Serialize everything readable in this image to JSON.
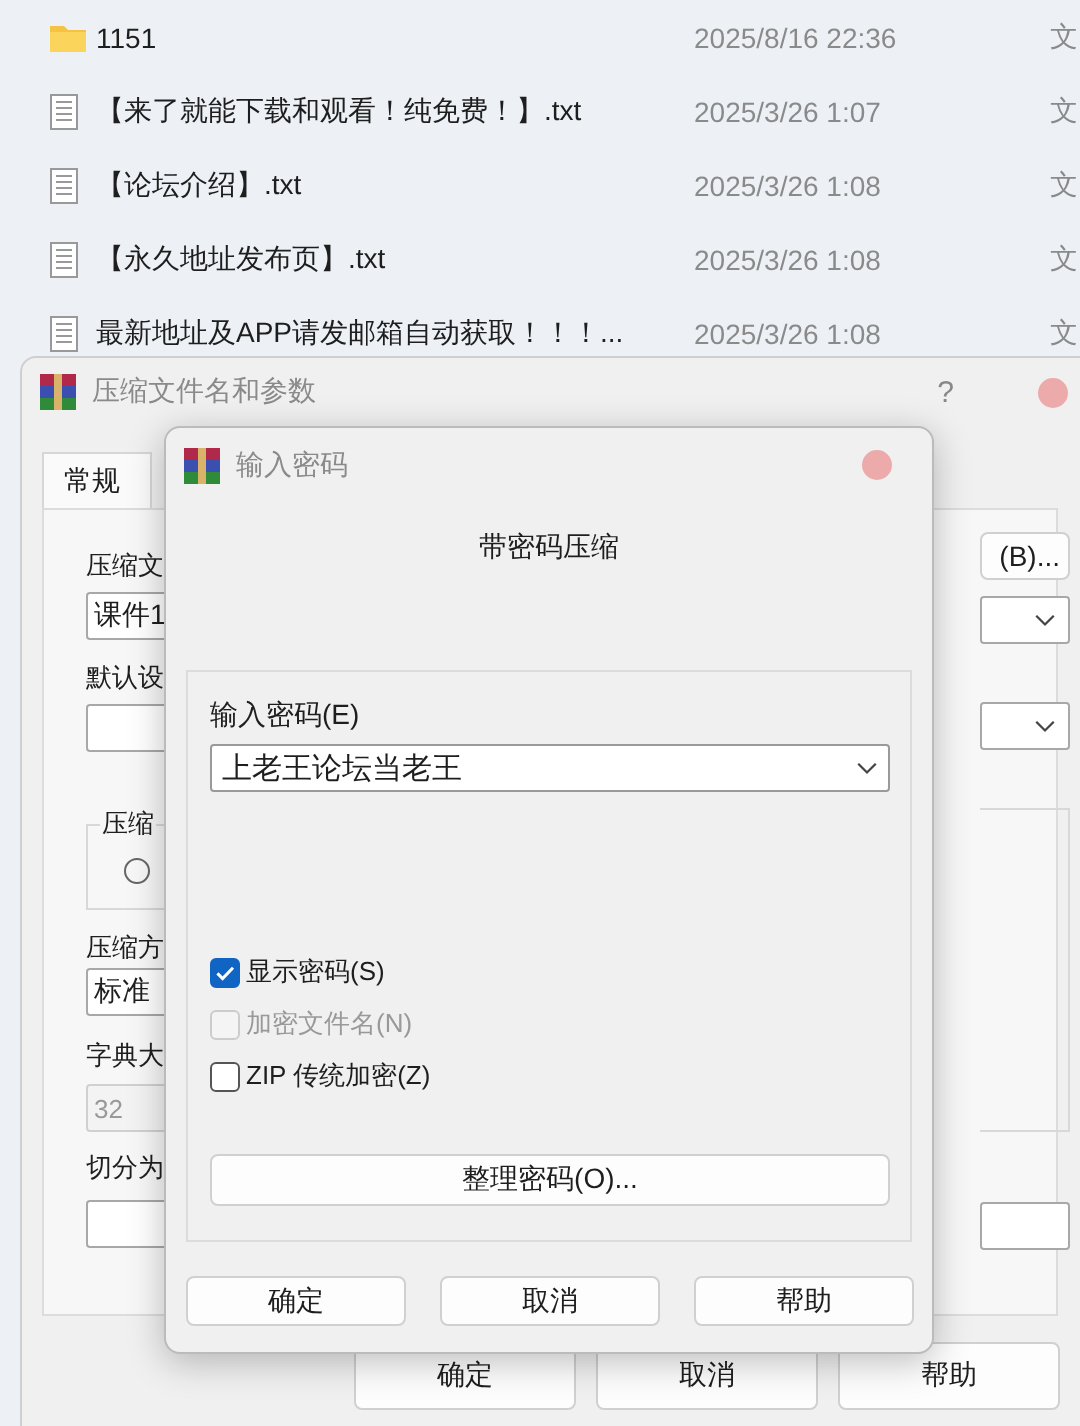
{
  "files": [
    {
      "kind": "folder",
      "name": "1151",
      "modified": "2025/8/16 22:36",
      "type": "文"
    },
    {
      "kind": "text",
      "name": "【来了就能下载和观看！纯免费！】.txt",
      "modified": "2025/3/26 1:07",
      "type": "文"
    },
    {
      "kind": "text",
      "name": "【论坛介绍】.txt",
      "modified": "2025/3/26 1:08",
      "type": "文"
    },
    {
      "kind": "text",
      "name": "【永久地址发布页】.txt",
      "modified": "2025/3/26 1:08",
      "type": "文"
    },
    {
      "kind": "text",
      "name": "最新地址及APP请发邮箱自动获取！！！...",
      "modified": "2025/3/26 1:08",
      "type": "文"
    }
  ],
  "archive_dialog": {
    "title": "压缩文件名和参数",
    "help": "?",
    "tabs": [
      {
        "label": "常规",
        "selected": true
      }
    ],
    "archive_name": {
      "label": "压缩文",
      "value": "课件1"
    },
    "browse_button": "(B)...",
    "profile_label": "默认设",
    "group_label": "压缩",
    "radio": {
      "selected": false
    },
    "method": {
      "label": "压缩方",
      "value": "标准"
    },
    "dictionary": {
      "label": "字典大",
      "value": "32",
      "disabled": true
    },
    "split_label": "切分为",
    "buttons": [
      "确定",
      "取消",
      "帮助"
    ]
  },
  "password_dialog": {
    "title": "输入密码",
    "heading": "带密码压缩",
    "password_label": "输入密码(E)",
    "password": "上老王论坛当老王",
    "options": [
      {
        "label": "显示密码(S)",
        "checked": true,
        "disabled": false
      },
      {
        "label": "加密文件名(N)",
        "checked": false,
        "disabled": true
      },
      {
        "label": "ZIP 传统加密(Z)",
        "checked": false,
        "disabled": false
      }
    ],
    "organize_button": "整理密码(O)...",
    "buttons": [
      "确定",
      "取消",
      "帮助"
    ]
  }
}
